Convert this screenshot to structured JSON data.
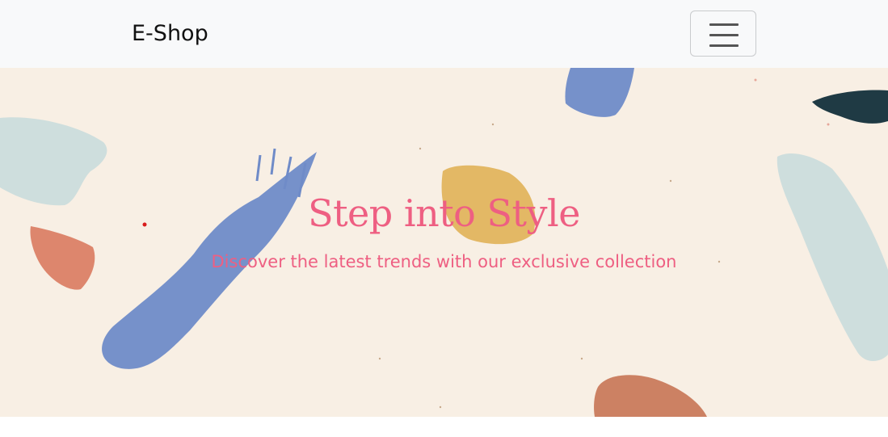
{
  "navbar": {
    "brand": "E-Shop",
    "toggler_icon": "hamburger-menu-icon"
  },
  "hero": {
    "title": "Step into Style",
    "subtitle": "Discover the latest trends with our exclusive collection",
    "background": "#f8efe4",
    "text_color": "#ee5f82"
  }
}
